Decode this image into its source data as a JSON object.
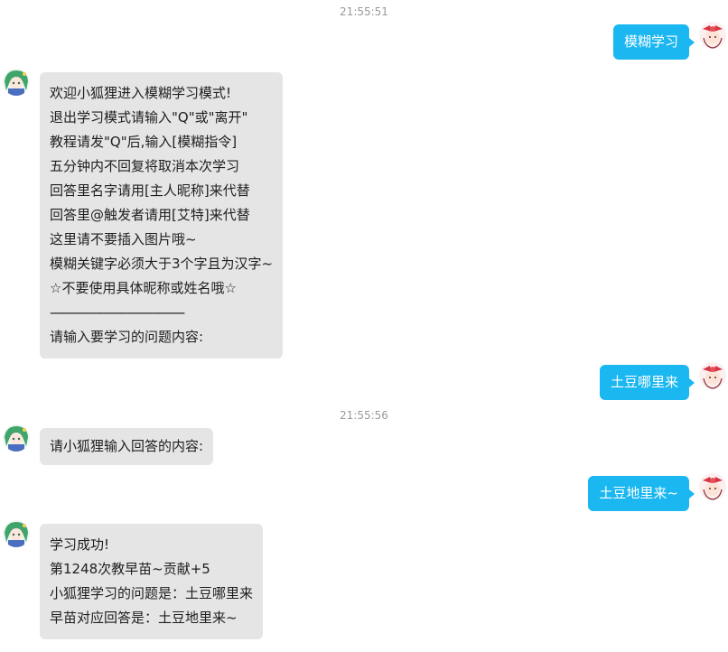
{
  "conversation": {
    "timestamps": [
      "21:55:51",
      "21:55:56"
    ],
    "messages": [
      {
        "side": "right",
        "lines": [
          "模糊学习"
        ]
      },
      {
        "side": "left",
        "lines": [
          "欢迎小狐狸进入模糊学习模式!",
          "退出学习模式请输入\"Q\"或\"离开\"",
          "教程请发\"Q\"后,输入[模糊指令]",
          "五分钟内不回复将取消本次学习",
          "回答里名字请用[主人昵称]来代替",
          "回答里@触发者请用[艾特]来代替",
          "这里请不要插入图片哦~",
          "模糊关键字必须大于3个字且为汉字~",
          "☆不要使用具体昵称或姓名哦☆",
          "--------------------------------------",
          "请输入要学习的问题内容:"
        ]
      },
      {
        "side": "right",
        "lines": [
          "土豆哪里来"
        ]
      },
      {
        "side": "left",
        "lines": [
          "请小狐狸输入回答的内容:"
        ]
      },
      {
        "side": "right",
        "lines": [
          "土豆地里来~"
        ]
      },
      {
        "side": "left",
        "lines": [
          "学习成功!",
          "第1248次教早苗~贡献+5",
          "小狐狸学习的问题是：土豆哪里来",
          "早苗对应回答是：土豆地里来~"
        ]
      }
    ]
  },
  "colors": {
    "self_bubble": "#1ab7f0",
    "other_bubble": "#e5e5e5",
    "timestamp": "#9a9a9a"
  },
  "icons": {
    "self_avatar": "avatar-red-bow-character-icon",
    "bot_avatar": "avatar-green-hair-character-icon"
  }
}
